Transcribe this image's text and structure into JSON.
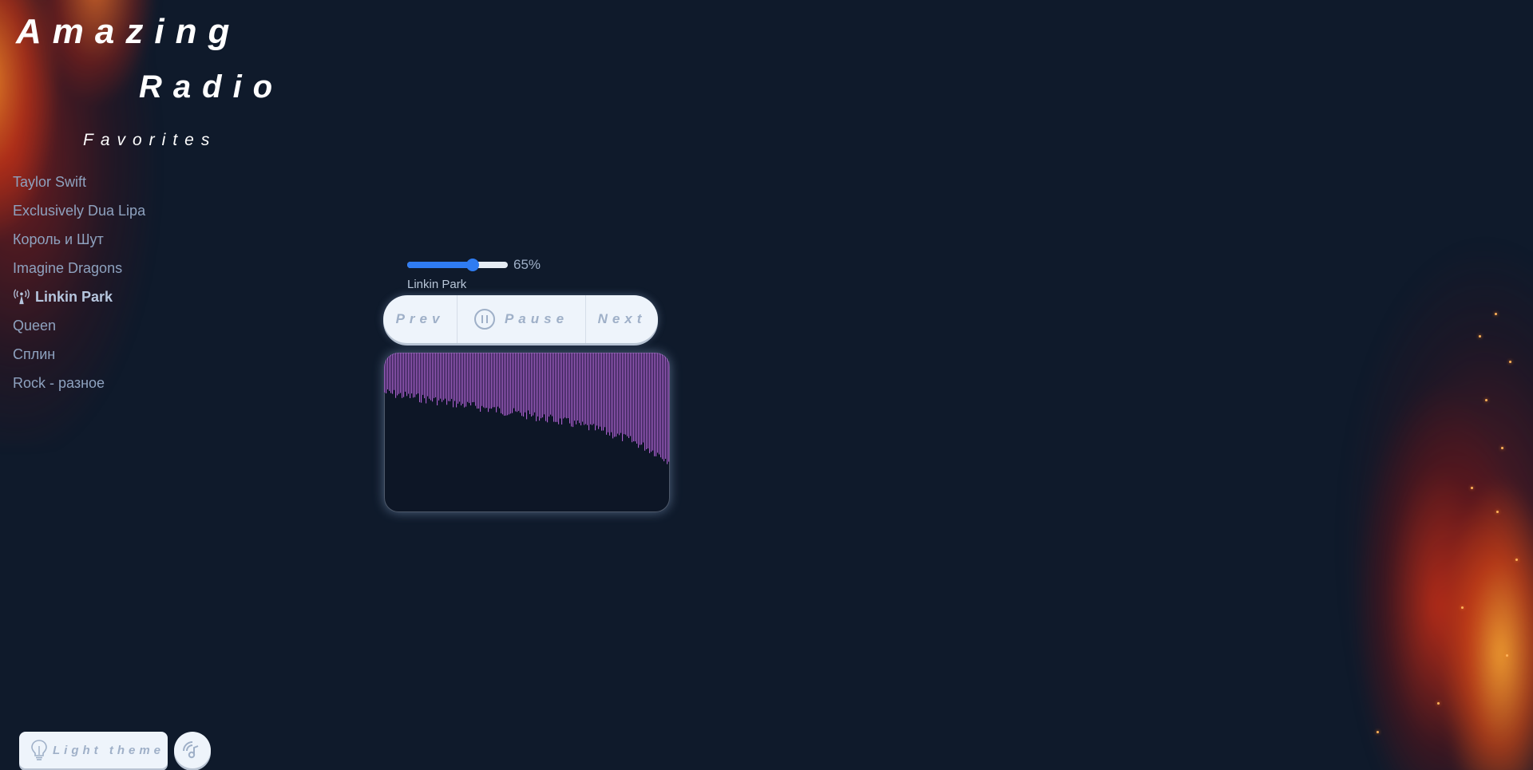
{
  "app": {
    "title_line1": "Amazing",
    "title_line2": "Radio"
  },
  "favorites": {
    "heading": "Favorites",
    "items": [
      {
        "label": "Taylor Swift",
        "active": false
      },
      {
        "label": "Exclusively Dua Lipa",
        "active": false
      },
      {
        "label": "Король и Шут",
        "active": false
      },
      {
        "label": "Imagine Dragons",
        "active": false
      },
      {
        "label": "Linkin Park",
        "active": true,
        "icon": "broadcast-antenna-icon"
      },
      {
        "label": "Queen",
        "active": false
      },
      {
        "label": "Сплин",
        "active": false
      },
      {
        "label": "Rock - разное",
        "active": false
      }
    ]
  },
  "player": {
    "volume_percent": 65,
    "volume_label": "65%",
    "now_playing": "Linkin Park",
    "prev_label": "Prev",
    "pause_label": "Pause",
    "next_label": "Next",
    "pause_icon": "pause-icon"
  },
  "visualizer": {
    "bar_color_start": "#c79bd6",
    "bar_color_end": "#7b18b4",
    "background": "#0d1626"
  },
  "footer": {
    "theme_button_label": "Light theme",
    "theme_icon": "lightbulb-icon",
    "radio_button_icon": "radio-wave-icon"
  },
  "colors": {
    "background": "#0f1a2b",
    "accent": "#2f7cf2",
    "text_muted": "#8ea2bf",
    "button_bg": "#eef4fb"
  }
}
